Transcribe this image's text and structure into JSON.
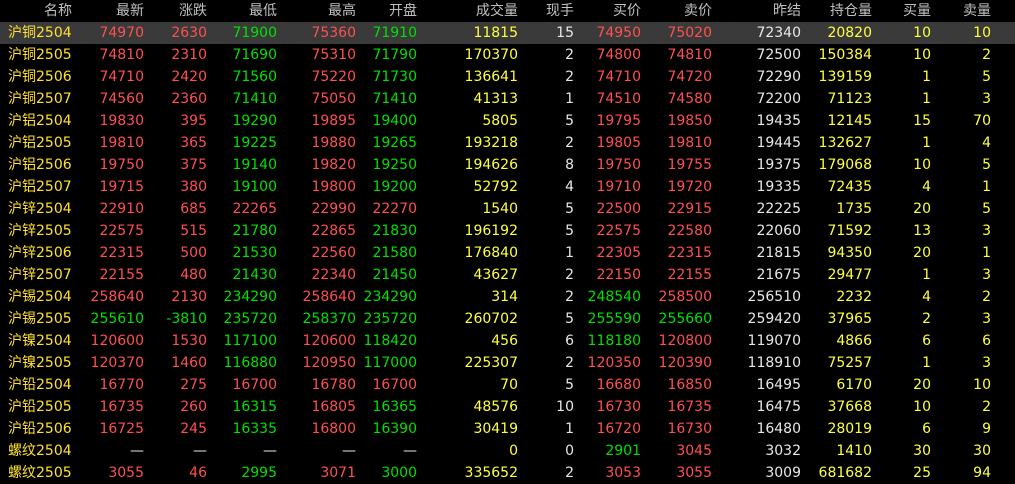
{
  "colors": {
    "up": "#ff5050",
    "down": "#00e000",
    "flat": "#e8e8e8",
    "volume": "#ffff40",
    "name": "#ffe030",
    "selected_row": "#3a3a3a"
  },
  "columns": [
    "名称",
    "最新",
    "涨跌",
    "最低",
    "最高",
    "开盘",
    "成交量",
    "现手",
    "买价",
    "卖价",
    "昨结",
    "持仓量",
    "买量",
    "卖量"
  ],
  "selected_row": 0,
  "rows": [
    {
      "name": "沪铜2504",
      "last": "74970",
      "chg": "2630",
      "low": "71900",
      "high": "75360",
      "open": "71910",
      "vol": "11815",
      "cur": "15",
      "bid": "74950",
      "ask": "75020",
      "prev": "72340",
      "oi": "20820",
      "bidv": "10",
      "askv": "10",
      "c": [
        "up",
        "up",
        "down",
        "up",
        "down",
        "y",
        "w",
        "up",
        "up",
        "w",
        "y",
        "y",
        "y"
      ]
    },
    {
      "name": "沪铜2505",
      "last": "74810",
      "chg": "2310",
      "low": "71690",
      "high": "75310",
      "open": "71790",
      "vol": "170370",
      "cur": "2",
      "bid": "74800",
      "ask": "74810",
      "prev": "72500",
      "oi": "150384",
      "bidv": "10",
      "askv": "2",
      "c": [
        "up",
        "up",
        "down",
        "up",
        "down",
        "y",
        "w",
        "up",
        "up",
        "w",
        "y",
        "y",
        "y"
      ]
    },
    {
      "name": "沪铜2506",
      "last": "74710",
      "chg": "2420",
      "low": "71560",
      "high": "75220",
      "open": "71730",
      "vol": "136641",
      "cur": "2",
      "bid": "74710",
      "ask": "74720",
      "prev": "72290",
      "oi": "139159",
      "bidv": "1",
      "askv": "5",
      "c": [
        "up",
        "up",
        "down",
        "up",
        "down",
        "y",
        "w",
        "up",
        "up",
        "w",
        "y",
        "y",
        "y"
      ]
    },
    {
      "name": "沪铜2507",
      "last": "74560",
      "chg": "2360",
      "low": "71410",
      "high": "75050",
      "open": "71410",
      "vol": "41313",
      "cur": "1",
      "bid": "74510",
      "ask": "74580",
      "prev": "72200",
      "oi": "71123",
      "bidv": "1",
      "askv": "3",
      "c": [
        "up",
        "up",
        "down",
        "up",
        "down",
        "y",
        "w",
        "up",
        "up",
        "w",
        "y",
        "y",
        "y"
      ]
    },
    {
      "name": "沪铝2504",
      "last": "19830",
      "chg": "395",
      "low": "19290",
      "high": "19895",
      "open": "19400",
      "vol": "5805",
      "cur": "5",
      "bid": "19795",
      "ask": "19850",
      "prev": "19435",
      "oi": "12145",
      "bidv": "15",
      "askv": "70",
      "c": [
        "up",
        "up",
        "down",
        "up",
        "down",
        "y",
        "w",
        "up",
        "up",
        "w",
        "y",
        "y",
        "y"
      ]
    },
    {
      "name": "沪铝2505",
      "last": "19810",
      "chg": "365",
      "low": "19225",
      "high": "19880",
      "open": "19265",
      "vol": "193218",
      "cur": "2",
      "bid": "19805",
      "ask": "19810",
      "prev": "19445",
      "oi": "132627",
      "bidv": "1",
      "askv": "4",
      "c": [
        "up",
        "up",
        "down",
        "up",
        "down",
        "y",
        "w",
        "up",
        "up",
        "w",
        "y",
        "y",
        "y"
      ]
    },
    {
      "name": "沪铝2506",
      "last": "19750",
      "chg": "375",
      "low": "19140",
      "high": "19820",
      "open": "19250",
      "vol": "194626",
      "cur": "8",
      "bid": "19750",
      "ask": "19755",
      "prev": "19375",
      "oi": "179068",
      "bidv": "10",
      "askv": "5",
      "c": [
        "up",
        "up",
        "down",
        "up",
        "down",
        "y",
        "w",
        "up",
        "up",
        "w",
        "y",
        "y",
        "y"
      ]
    },
    {
      "name": "沪铝2507",
      "last": "19715",
      "chg": "380",
      "low": "19100",
      "high": "19800",
      "open": "19200",
      "vol": "52792",
      "cur": "4",
      "bid": "19710",
      "ask": "19720",
      "prev": "19335",
      "oi": "72435",
      "bidv": "4",
      "askv": "1",
      "c": [
        "up",
        "up",
        "down",
        "up",
        "down",
        "y",
        "w",
        "up",
        "up",
        "w",
        "y",
        "y",
        "y"
      ]
    },
    {
      "name": "沪锌2504",
      "last": "22910",
      "chg": "685",
      "low": "22265",
      "high": "22990",
      "open": "22270",
      "vol": "1540",
      "cur": "5",
      "bid": "22500",
      "ask": "22915",
      "prev": "22225",
      "oi": "1735",
      "bidv": "20",
      "askv": "5",
      "c": [
        "up",
        "up",
        "up",
        "up",
        "up",
        "y",
        "w",
        "up",
        "up",
        "w",
        "y",
        "y",
        "y"
      ]
    },
    {
      "name": "沪锌2505",
      "last": "22575",
      "chg": "515",
      "low": "21780",
      "high": "22865",
      "open": "21830",
      "vol": "196192",
      "cur": "5",
      "bid": "22575",
      "ask": "22580",
      "prev": "22060",
      "oi": "71592",
      "bidv": "13",
      "askv": "3",
      "c": [
        "up",
        "up",
        "down",
        "up",
        "down",
        "y",
        "w",
        "up",
        "up",
        "w",
        "y",
        "y",
        "y"
      ]
    },
    {
      "name": "沪锌2506",
      "last": "22315",
      "chg": "500",
      "low": "21530",
      "high": "22560",
      "open": "21580",
      "vol": "176840",
      "cur": "1",
      "bid": "22305",
      "ask": "22315",
      "prev": "21815",
      "oi": "94350",
      "bidv": "20",
      "askv": "1",
      "c": [
        "up",
        "up",
        "down",
        "up",
        "down",
        "y",
        "w",
        "up",
        "up",
        "w",
        "y",
        "y",
        "y"
      ]
    },
    {
      "name": "沪锌2507",
      "last": "22155",
      "chg": "480",
      "low": "21430",
      "high": "22340",
      "open": "21450",
      "vol": "43627",
      "cur": "2",
      "bid": "22150",
      "ask": "22155",
      "prev": "21675",
      "oi": "29477",
      "bidv": "1",
      "askv": "3",
      "c": [
        "up",
        "up",
        "down",
        "up",
        "down",
        "y",
        "w",
        "up",
        "up",
        "w",
        "y",
        "y",
        "y"
      ]
    },
    {
      "name": "沪锡2504",
      "last": "258640",
      "chg": "2130",
      "low": "234290",
      "high": "258640",
      "open": "234290",
      "vol": "314",
      "cur": "2",
      "bid": "248540",
      "ask": "258500",
      "prev": "256510",
      "oi": "2232",
      "bidv": "4",
      "askv": "2",
      "c": [
        "up",
        "up",
        "down",
        "up",
        "down",
        "y",
        "w",
        "down",
        "up",
        "w",
        "y",
        "y",
        "y"
      ]
    },
    {
      "name": "沪锡2505",
      "last": "255610",
      "chg": "-3810",
      "low": "235720",
      "high": "258370",
      "open": "235720",
      "vol": "260702",
      "cur": "5",
      "bid": "255590",
      "ask": "255660",
      "prev": "259420",
      "oi": "37965",
      "bidv": "2",
      "askv": "3",
      "c": [
        "down",
        "down",
        "down",
        "down",
        "down",
        "y",
        "w",
        "down",
        "down",
        "w",
        "y",
        "y",
        "y"
      ]
    },
    {
      "name": "沪镍2504",
      "last": "120600",
      "chg": "1530",
      "low": "117100",
      "high": "120600",
      "open": "118420",
      "vol": "456",
      "cur": "6",
      "bid": "118180",
      "ask": "120800",
      "prev": "119070",
      "oi": "4866",
      "bidv": "6",
      "askv": "6",
      "c": [
        "up",
        "up",
        "down",
        "up",
        "down",
        "y",
        "w",
        "down",
        "up",
        "w",
        "y",
        "y",
        "y"
      ]
    },
    {
      "name": "沪镍2505",
      "last": "120370",
      "chg": "1460",
      "low": "116880",
      "high": "120950",
      "open": "117000",
      "vol": "225307",
      "cur": "2",
      "bid": "120350",
      "ask": "120390",
      "prev": "118910",
      "oi": "75257",
      "bidv": "1",
      "askv": "3",
      "c": [
        "up",
        "up",
        "down",
        "up",
        "down",
        "y",
        "w",
        "up",
        "up",
        "w",
        "y",
        "y",
        "y"
      ]
    },
    {
      "name": "沪铅2504",
      "last": "16770",
      "chg": "275",
      "low": "16700",
      "high": "16780",
      "open": "16700",
      "vol": "70",
      "cur": "5",
      "bid": "16680",
      "ask": "16850",
      "prev": "16495",
      "oi": "6170",
      "bidv": "20",
      "askv": "10",
      "c": [
        "up",
        "up",
        "up",
        "up",
        "up",
        "y",
        "w",
        "up",
        "up",
        "w",
        "y",
        "y",
        "y"
      ]
    },
    {
      "name": "沪铅2505",
      "last": "16735",
      "chg": "260",
      "low": "16315",
      "high": "16805",
      "open": "16365",
      "vol": "48576",
      "cur": "10",
      "bid": "16730",
      "ask": "16735",
      "prev": "16475",
      "oi": "37668",
      "bidv": "10",
      "askv": "2",
      "c": [
        "up",
        "up",
        "down",
        "up",
        "down",
        "y",
        "w",
        "up",
        "up",
        "w",
        "y",
        "y",
        "y"
      ]
    },
    {
      "name": "沪铅2506",
      "last": "16725",
      "chg": "245",
      "low": "16335",
      "high": "16800",
      "open": "16390",
      "vol": "30419",
      "cur": "1",
      "bid": "16720",
      "ask": "16730",
      "prev": "16480",
      "oi": "28019",
      "bidv": "6",
      "askv": "9",
      "c": [
        "up",
        "up",
        "down",
        "up",
        "down",
        "y",
        "w",
        "up",
        "up",
        "w",
        "y",
        "y",
        "y"
      ]
    },
    {
      "name": "螺纹2504",
      "last": "—",
      "chg": "—",
      "low": "—",
      "high": "—",
      "open": "—",
      "vol": "0",
      "cur": "0",
      "bid": "2901",
      "ask": "3045",
      "prev": "3032",
      "oi": "1410",
      "bidv": "30",
      "askv": "30",
      "c": [
        "flat",
        "flat",
        "flat",
        "flat",
        "flat",
        "y",
        "w",
        "down",
        "up",
        "w",
        "y",
        "y",
        "y"
      ]
    },
    {
      "name": "螺纹2505",
      "last": "3055",
      "chg": "46",
      "low": "2995",
      "high": "3071",
      "open": "3000",
      "vol": "335652",
      "cur": "2",
      "bid": "3053",
      "ask": "3055",
      "prev": "3009",
      "oi": "681682",
      "bidv": "25",
      "askv": "94",
      "c": [
        "up",
        "up",
        "down",
        "up",
        "down",
        "y",
        "w",
        "up",
        "up",
        "w",
        "y",
        "y",
        "y"
      ]
    }
  ]
}
